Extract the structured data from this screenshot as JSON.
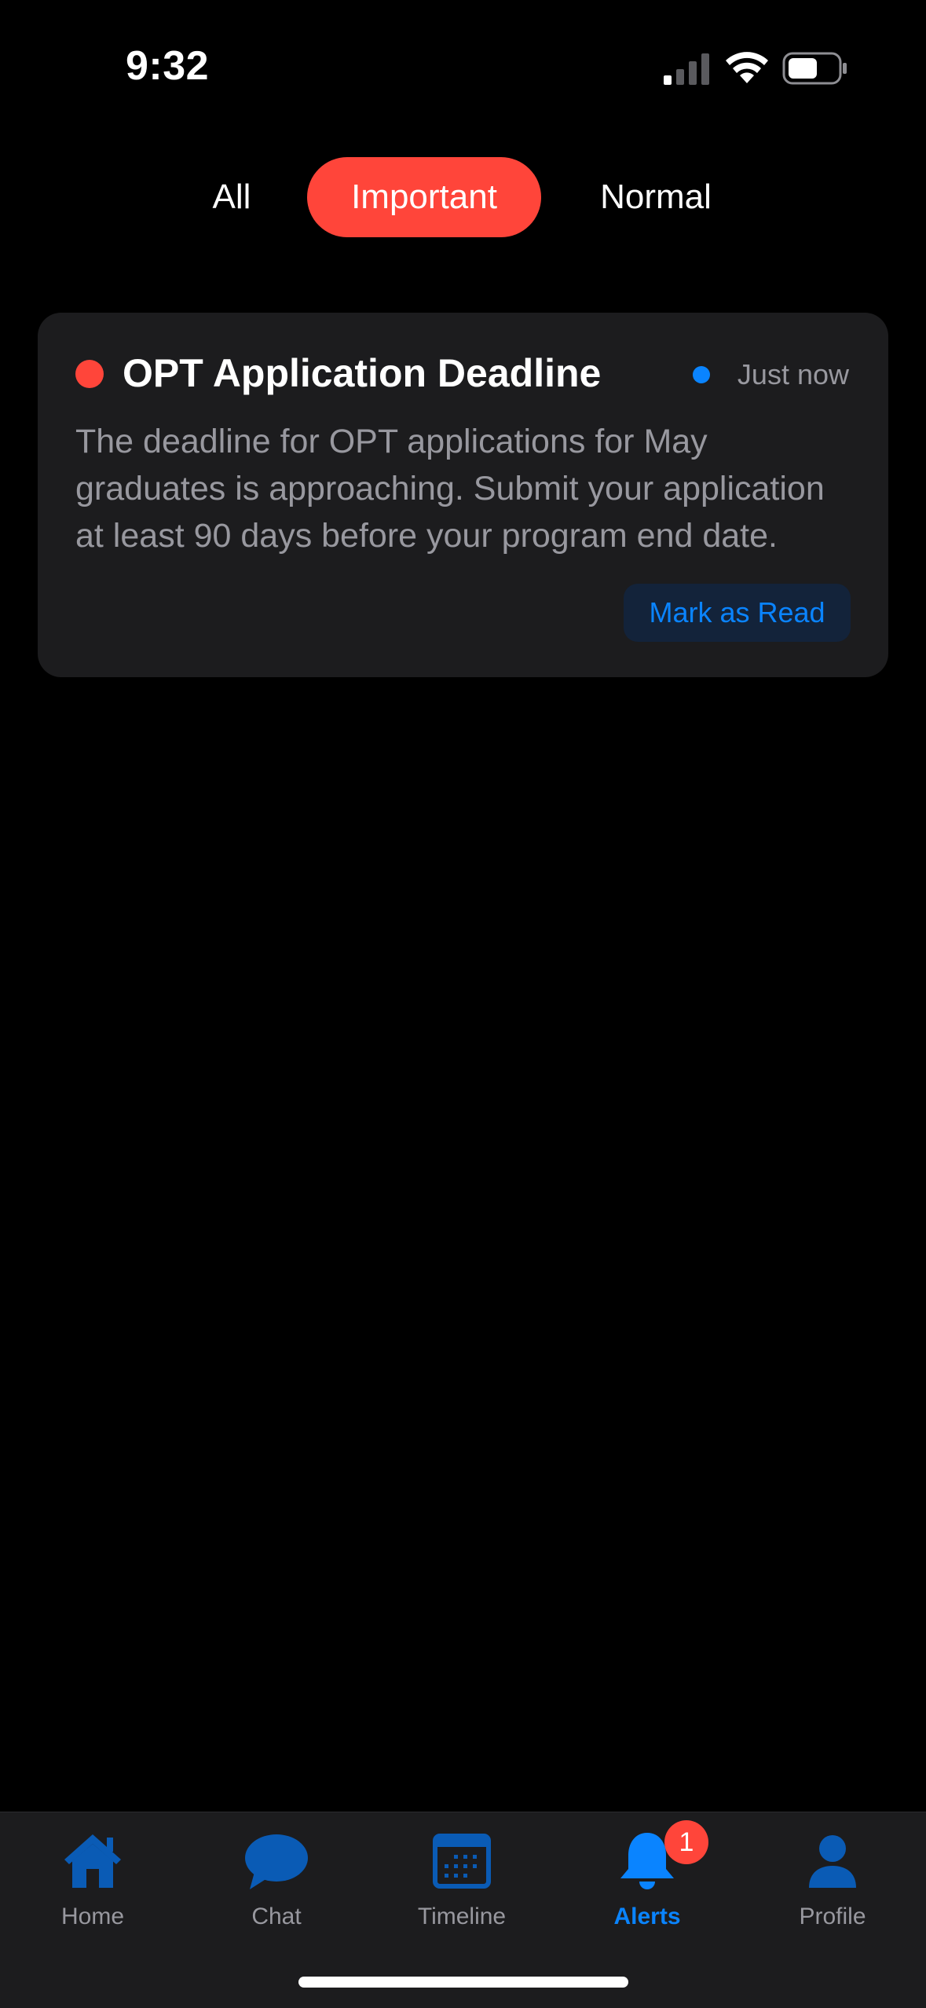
{
  "status_bar": {
    "time": "9:32"
  },
  "filters": {
    "all_label": "All",
    "important_label": "Important",
    "normal_label": "Normal",
    "selected": "Important",
    "selected_color": "#ff453a"
  },
  "notification": {
    "title": "OPT Application Deadline",
    "time": "Just now",
    "body": "The deadline for OPT applications for May graduates is approaching. Submit your application at least 90 days before your program end date.",
    "priority_color": "#ff453a",
    "unread_color": "#0a84ff",
    "action_label": "Mark as Read"
  },
  "tab_bar": {
    "tabs": [
      {
        "label": "Home",
        "icon": "house-icon"
      },
      {
        "label": "Chat",
        "icon": "chat-bubble-icon"
      },
      {
        "label": "Timeline",
        "icon": "calendar-icon"
      },
      {
        "label": "Alerts",
        "icon": "bell-icon",
        "active": true,
        "badge": "1"
      },
      {
        "label": "Profile",
        "icon": "person-icon"
      }
    ],
    "accent_color": "#0a84ff"
  }
}
